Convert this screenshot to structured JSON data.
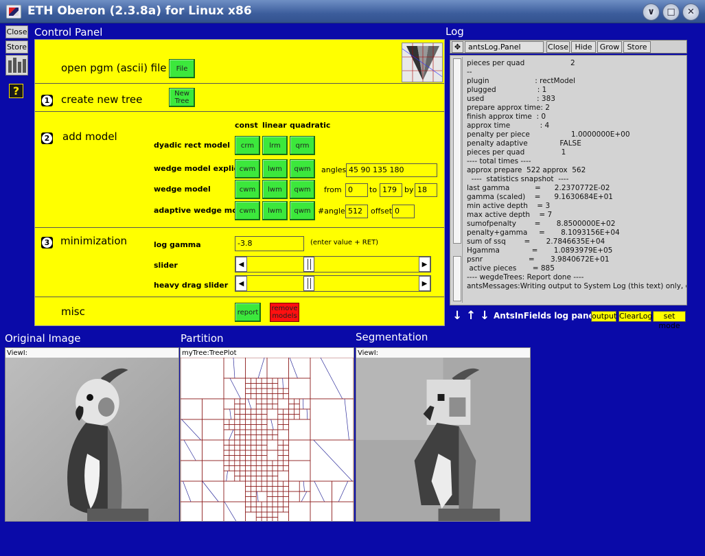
{
  "window": {
    "title": "ETH Oberon (2.3.8a) for Linux x86"
  },
  "tools": {
    "close": "Close",
    "store": "Store",
    "help": "?"
  },
  "control_panel": {
    "title": "Control Panel",
    "open_label": "open pgm (ascii) file",
    "file_button": "File",
    "create_label": "create new tree",
    "new_tree_button": "New Tree",
    "add_model_label": "add model",
    "col_const": "const",
    "col_linear": "linear",
    "col_quadratic": "quadratic",
    "rows": [
      {
        "label": "dyadic rect model",
        "buttons": [
          "crm",
          "lrm",
          "qrm"
        ]
      },
      {
        "label": "wedge model explicit",
        "buttons": [
          "cwm",
          "lwm",
          "qwm"
        ]
      },
      {
        "label": "wedge model",
        "buttons": [
          "cwm",
          "lwm",
          "qwm"
        ]
      },
      {
        "label": "adaptive wedge model",
        "buttons": [
          "cwm",
          "lwm",
          "qwm"
        ]
      }
    ],
    "angles_label": "angles",
    "angles_value": "45 90 135 180",
    "from_label": "from",
    "from_value": "0",
    "to_label": "to",
    "to_value": "179",
    "by_label": "by",
    "by_value": "18",
    "nangles_label": "#angles",
    "nangles_value": "512",
    "offset_label": "offset",
    "offset_value": "0",
    "minimization_label": "minimization",
    "loggamma_label": "log gamma",
    "loggamma_value": "-3.8",
    "loggamma_hint": "(enter value + RET)",
    "slider_label": "slider",
    "heavy_slider_label": "heavy drag slider",
    "slider_position": 0.35,
    "heavy_slider_position": 0.35,
    "misc_label": "misc",
    "report_button": "report",
    "remove_models_button": "remove models",
    "num1": "1",
    "num2": "2",
    "num3": "3"
  },
  "log": {
    "title": "Log",
    "panel_name": "antsLog.Panel",
    "buttons": {
      "close": "Close",
      "hide": "Hide",
      "grow": "Grow",
      "store": "Store"
    },
    "lines": [
      "pieces per quad                    2",
      "--",
      "plugin                    : rectModel",
      "plugged                  : 1",
      "used                       : 383",
      "prepare approx time: 2",
      "finish approx time  : 0",
      "approx time             : 4",
      "penalty per piece                  1.0000000E+00",
      "penalty adaptive              FALSE",
      "pieces per quad                1",
      "---- total times ----",
      "approx prepare  522 approx  562",
      "  ----  statistics snapshot  ----",
      "last gamma           =      2.2370772E-02",
      "gamma (scaled)    =      9.1630684E+01",
      "min active depth    = 3",
      "max active depth    = 7",
      "sumofpenalty        =       8.8500000E+02",
      "penalty+gamma     =       8.1093156E+04",
      "sum of ssq        =       2.7846635E+04",
      "Hgamma              =       1.0893979E+05",
      "psnr                    =       3.9840672E+01",
      " active pieces       = 885",
      "---- wegdeTrees: Report done ----",
      "antsMessages:Writing output to System Log (this text) only, caret"
    ],
    "footer_label": "AntsInFields log panel",
    "output_button": "output",
    "clearlog_button": "ClearLog",
    "setmode_button": "set mode"
  },
  "viewers": {
    "original_title": "Original Image",
    "partition_title": "Partition",
    "segmentation_title": "Segmentation",
    "original_label": "ViewI:",
    "partition_label": "myTree:TreePlot",
    "segmentation_label": "ViewI:"
  }
}
